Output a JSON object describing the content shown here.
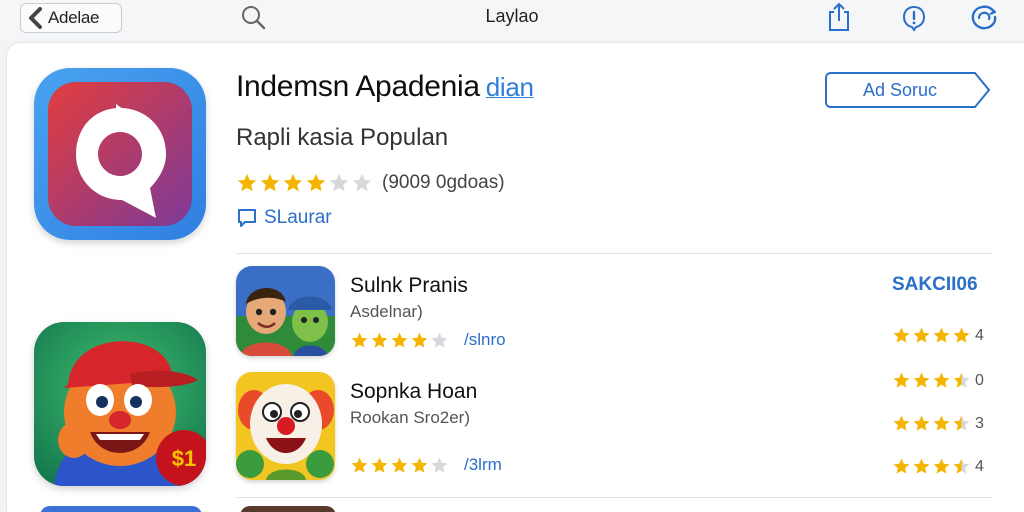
{
  "topbar": {
    "back_label": "Adelae",
    "title": "Laylao"
  },
  "app": {
    "title": "Indemsn Apadenia",
    "title_tag": "dian",
    "subtitle": "Rapli kasia Populan",
    "rating": 4,
    "rating_count": "(9009 0gdoas)",
    "support_label": "SLaurar",
    "primary_button": "Ad Soruc"
  },
  "section": {
    "link_label": "SAKCII06"
  },
  "list": [
    {
      "title": "Sulnk Pranis",
      "subtitle": "Asdelnar)",
      "rating": 4,
      "meta": "/slnro"
    },
    {
      "title": "Sopnka Hoan",
      "subtitle": "Rookan Sro2er)",
      "rating": 4,
      "meta": "/3lrm"
    }
  ],
  "side_ratings": [
    {
      "stars": 4,
      "value": "4"
    },
    {
      "stars": 3.5,
      "value": "0"
    },
    {
      "stars": 3.5,
      "value": "3"
    },
    {
      "stars": 3.5,
      "value": "4"
    }
  ],
  "colors": {
    "accent": "#2a6fc8",
    "star": "#f4b400",
    "star_empty": "#d6d8dc"
  },
  "icons": {
    "back": "chevron-left-icon",
    "search": "search-icon",
    "share": "share-icon",
    "alert": "alert-icon",
    "refresh": "refresh-icon",
    "support": "chat-bubble-icon"
  }
}
